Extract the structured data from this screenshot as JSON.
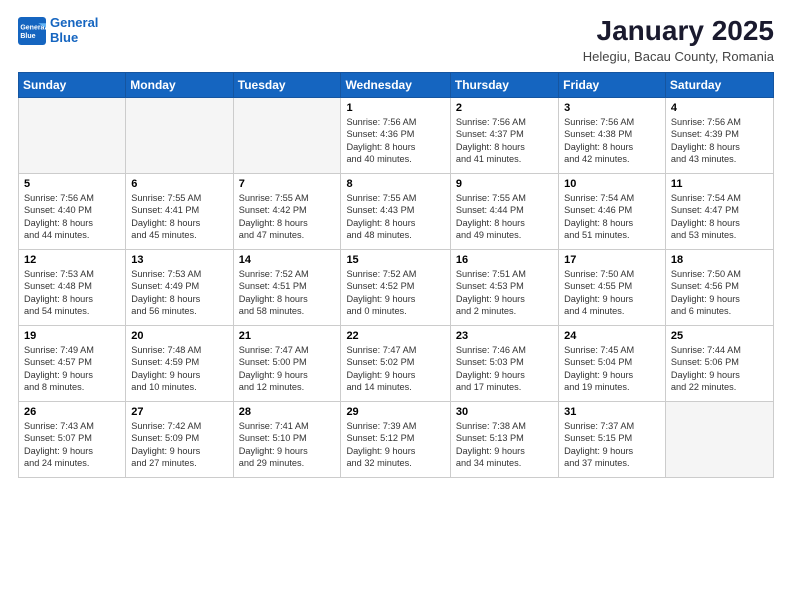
{
  "logo": {
    "line1": "General",
    "line2": "Blue"
  },
  "title": "January 2025",
  "subtitle": "Helegiu, Bacau County, Romania",
  "weekdays": [
    "Sunday",
    "Monday",
    "Tuesday",
    "Wednesday",
    "Thursday",
    "Friday",
    "Saturday"
  ],
  "weeks": [
    [
      {
        "day": "",
        "text": ""
      },
      {
        "day": "",
        "text": ""
      },
      {
        "day": "",
        "text": ""
      },
      {
        "day": "1",
        "text": "Sunrise: 7:56 AM\nSunset: 4:36 PM\nDaylight: 8 hours\nand 40 minutes."
      },
      {
        "day": "2",
        "text": "Sunrise: 7:56 AM\nSunset: 4:37 PM\nDaylight: 8 hours\nand 41 minutes."
      },
      {
        "day": "3",
        "text": "Sunrise: 7:56 AM\nSunset: 4:38 PM\nDaylight: 8 hours\nand 42 minutes."
      },
      {
        "day": "4",
        "text": "Sunrise: 7:56 AM\nSunset: 4:39 PM\nDaylight: 8 hours\nand 43 minutes."
      }
    ],
    [
      {
        "day": "5",
        "text": "Sunrise: 7:56 AM\nSunset: 4:40 PM\nDaylight: 8 hours\nand 44 minutes."
      },
      {
        "day": "6",
        "text": "Sunrise: 7:55 AM\nSunset: 4:41 PM\nDaylight: 8 hours\nand 45 minutes."
      },
      {
        "day": "7",
        "text": "Sunrise: 7:55 AM\nSunset: 4:42 PM\nDaylight: 8 hours\nand 47 minutes."
      },
      {
        "day": "8",
        "text": "Sunrise: 7:55 AM\nSunset: 4:43 PM\nDaylight: 8 hours\nand 48 minutes."
      },
      {
        "day": "9",
        "text": "Sunrise: 7:55 AM\nSunset: 4:44 PM\nDaylight: 8 hours\nand 49 minutes."
      },
      {
        "day": "10",
        "text": "Sunrise: 7:54 AM\nSunset: 4:46 PM\nDaylight: 8 hours\nand 51 minutes."
      },
      {
        "day": "11",
        "text": "Sunrise: 7:54 AM\nSunset: 4:47 PM\nDaylight: 8 hours\nand 53 minutes."
      }
    ],
    [
      {
        "day": "12",
        "text": "Sunrise: 7:53 AM\nSunset: 4:48 PM\nDaylight: 8 hours\nand 54 minutes."
      },
      {
        "day": "13",
        "text": "Sunrise: 7:53 AM\nSunset: 4:49 PM\nDaylight: 8 hours\nand 56 minutes."
      },
      {
        "day": "14",
        "text": "Sunrise: 7:52 AM\nSunset: 4:51 PM\nDaylight: 8 hours\nand 58 minutes."
      },
      {
        "day": "15",
        "text": "Sunrise: 7:52 AM\nSunset: 4:52 PM\nDaylight: 9 hours\nand 0 minutes."
      },
      {
        "day": "16",
        "text": "Sunrise: 7:51 AM\nSunset: 4:53 PM\nDaylight: 9 hours\nand 2 minutes."
      },
      {
        "day": "17",
        "text": "Sunrise: 7:50 AM\nSunset: 4:55 PM\nDaylight: 9 hours\nand 4 minutes."
      },
      {
        "day": "18",
        "text": "Sunrise: 7:50 AM\nSunset: 4:56 PM\nDaylight: 9 hours\nand 6 minutes."
      }
    ],
    [
      {
        "day": "19",
        "text": "Sunrise: 7:49 AM\nSunset: 4:57 PM\nDaylight: 9 hours\nand 8 minutes."
      },
      {
        "day": "20",
        "text": "Sunrise: 7:48 AM\nSunset: 4:59 PM\nDaylight: 9 hours\nand 10 minutes."
      },
      {
        "day": "21",
        "text": "Sunrise: 7:47 AM\nSunset: 5:00 PM\nDaylight: 9 hours\nand 12 minutes."
      },
      {
        "day": "22",
        "text": "Sunrise: 7:47 AM\nSunset: 5:02 PM\nDaylight: 9 hours\nand 14 minutes."
      },
      {
        "day": "23",
        "text": "Sunrise: 7:46 AM\nSunset: 5:03 PM\nDaylight: 9 hours\nand 17 minutes."
      },
      {
        "day": "24",
        "text": "Sunrise: 7:45 AM\nSunset: 5:04 PM\nDaylight: 9 hours\nand 19 minutes."
      },
      {
        "day": "25",
        "text": "Sunrise: 7:44 AM\nSunset: 5:06 PM\nDaylight: 9 hours\nand 22 minutes."
      }
    ],
    [
      {
        "day": "26",
        "text": "Sunrise: 7:43 AM\nSunset: 5:07 PM\nDaylight: 9 hours\nand 24 minutes."
      },
      {
        "day": "27",
        "text": "Sunrise: 7:42 AM\nSunset: 5:09 PM\nDaylight: 9 hours\nand 27 minutes."
      },
      {
        "day": "28",
        "text": "Sunrise: 7:41 AM\nSunset: 5:10 PM\nDaylight: 9 hours\nand 29 minutes."
      },
      {
        "day": "29",
        "text": "Sunrise: 7:39 AM\nSunset: 5:12 PM\nDaylight: 9 hours\nand 32 minutes."
      },
      {
        "day": "30",
        "text": "Sunrise: 7:38 AM\nSunset: 5:13 PM\nDaylight: 9 hours\nand 34 minutes."
      },
      {
        "day": "31",
        "text": "Sunrise: 7:37 AM\nSunset: 5:15 PM\nDaylight: 9 hours\nand 37 minutes."
      },
      {
        "day": "",
        "text": ""
      }
    ]
  ]
}
